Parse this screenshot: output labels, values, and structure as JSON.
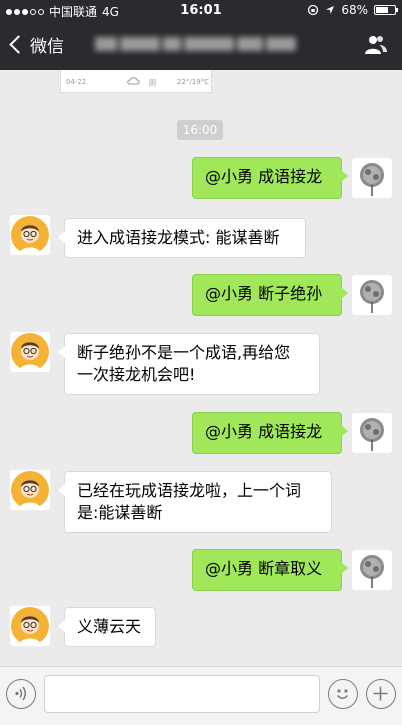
{
  "status_bar": {
    "carrier": "中国联通",
    "network": "4G",
    "time": "16:01",
    "battery": "68%",
    "battery_level": 0.68
  },
  "nav": {
    "back_label": "微信",
    "title_redacted": true
  },
  "history_card": {
    "date": "04-22",
    "weather": "阴",
    "temp": "22°/19°C"
  },
  "timestamp": "16:00",
  "messages": [
    {
      "sender": "me",
      "text": "@小勇 成语接龙"
    },
    {
      "sender": "bot",
      "text": "进入成语接龙模式: 能谋善断"
    },
    {
      "sender": "me",
      "text": "@小勇 断子绝孙"
    },
    {
      "sender": "bot",
      "text": "断子绝孙不是一个成语,再给您\n一次接龙机会吧!"
    },
    {
      "sender": "me",
      "text": "@小勇 成语接龙"
    },
    {
      "sender": "bot",
      "text": "已经在玩成语接龙啦，上一个词\n是:能谋善断"
    },
    {
      "sender": "me",
      "text": "@小勇 断章取义"
    },
    {
      "sender": "bot",
      "text": "义薄云天"
    }
  ],
  "icons": {
    "back": "chevron-left-icon",
    "contacts": "people-icon",
    "voice": "voice-icon",
    "emoji": "emoji-icon",
    "plus": "plus-icon"
  },
  "colors": {
    "nav_bg": "#2b2b2f",
    "chat_bg": "#ebebeb",
    "my_bubble": "#a0e75a",
    "bot_bubble": "#ffffff"
  }
}
